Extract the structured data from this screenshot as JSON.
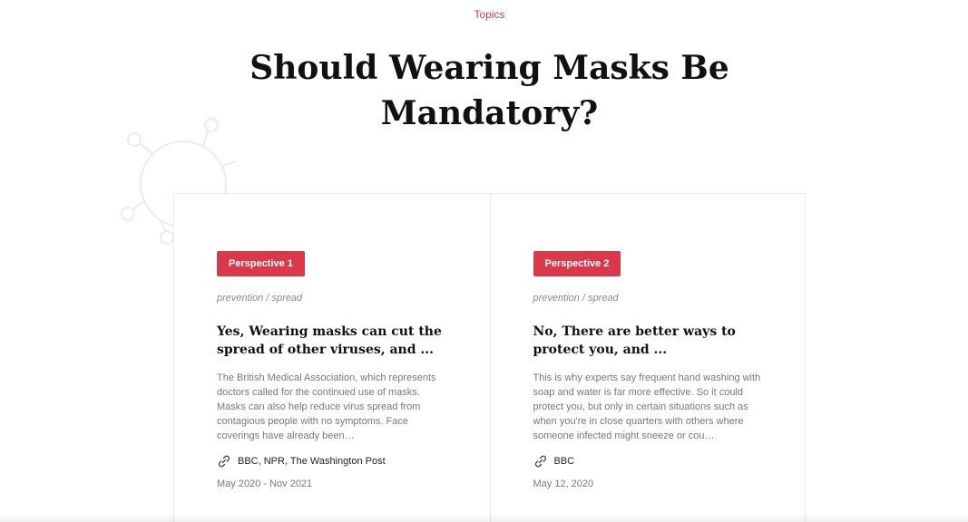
{
  "header": {
    "topics_link": "Topics",
    "title_line1": "Should Wearing Masks Be",
    "title_line2": "Mandatory?"
  },
  "icons": {
    "background": "virus-icon",
    "source": "link-icon"
  },
  "colors": {
    "accent": "#d9394b",
    "card_border": "#eaeaea",
    "muted_text": "#777777"
  },
  "perspectives": [
    {
      "badge": "Perspective 1",
      "tags": "prevention / spread",
      "title": "Yes, Wearing masks can cut the spread of other viruses, and ...",
      "summary": "The British Medical Association, which represents doctors called for the continued use of masks. Masks can also help reduce virus spread from contagious people with no symptoms. Face coverings have already been…",
      "sources": "BBC, NPR, The Washington Post",
      "date": "May 2020 - Nov 2021"
    },
    {
      "badge": "Perspective 2",
      "tags": "prevention / spread",
      "title": "No, There are better ways to protect you, and ...",
      "summary": "This is why experts say frequent hand washing with soap and water is far more effective. So it could protect you, but only in certain situations such as when you're in close quarters with others where someone infected might sneeze or cou…",
      "sources": "BBC",
      "date": "May 12, 2020"
    }
  ]
}
